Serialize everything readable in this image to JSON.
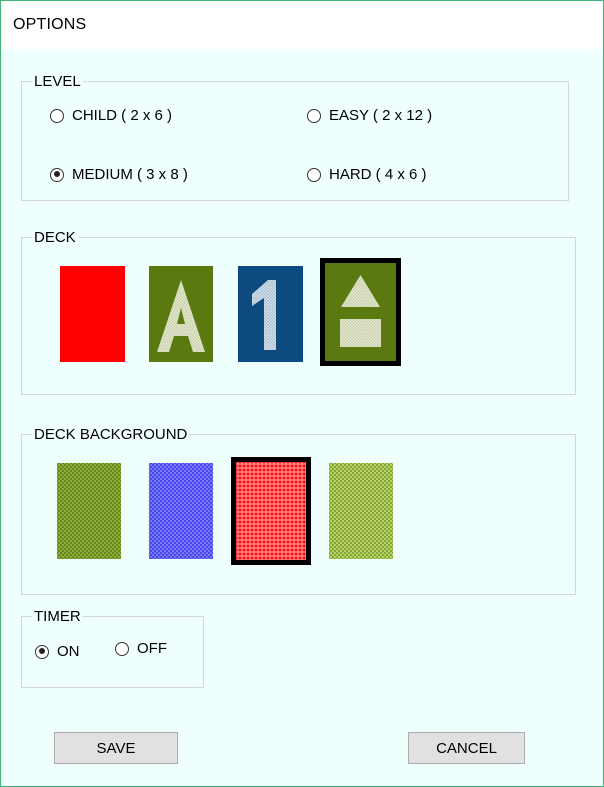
{
  "window": {
    "title": "OPTIONS"
  },
  "level": {
    "label": "LEVEL",
    "options": [
      {
        "label": "CHILD ( 2 x 6 )",
        "checked": false
      },
      {
        "label": "EASY ( 2 x 12 )",
        "checked": false
      },
      {
        "label": "MEDIUM ( 3 x 8 )",
        "checked": true
      },
      {
        "label": "HARD ( 4 x 6 )",
        "checked": false
      }
    ]
  },
  "deck": {
    "label": "DECK",
    "cards": [
      {
        "name": "red-plain",
        "color": "#ff0000",
        "glyph": "",
        "selected": false
      },
      {
        "name": "letter-a",
        "color": "#5a7a10",
        "glyph": "A",
        "selected": false
      },
      {
        "name": "number-1",
        "color": "#0d4a7f",
        "glyph": "1",
        "selected": false
      },
      {
        "name": "shapes",
        "color": "#5a7a10",
        "glyph": "",
        "selected": true
      }
    ]
  },
  "deck_background": {
    "label": "DECK BACKGROUND",
    "cards": [
      {
        "name": "olive-weave",
        "color": "#6b8a1e",
        "selected": false
      },
      {
        "name": "blue-weave",
        "color": "#4d4dff",
        "selected": false
      },
      {
        "name": "red-plaid",
        "color": "#ff1a1a",
        "selected": true
      },
      {
        "name": "light-olive-weave",
        "color": "#7fa02a",
        "selected": false
      }
    ]
  },
  "timer": {
    "label": "TIMER",
    "options": [
      {
        "label": "ON",
        "checked": true
      },
      {
        "label": "OFF",
        "checked": false
      }
    ]
  },
  "buttons": {
    "save": "SAVE",
    "cancel": "CANCEL"
  }
}
